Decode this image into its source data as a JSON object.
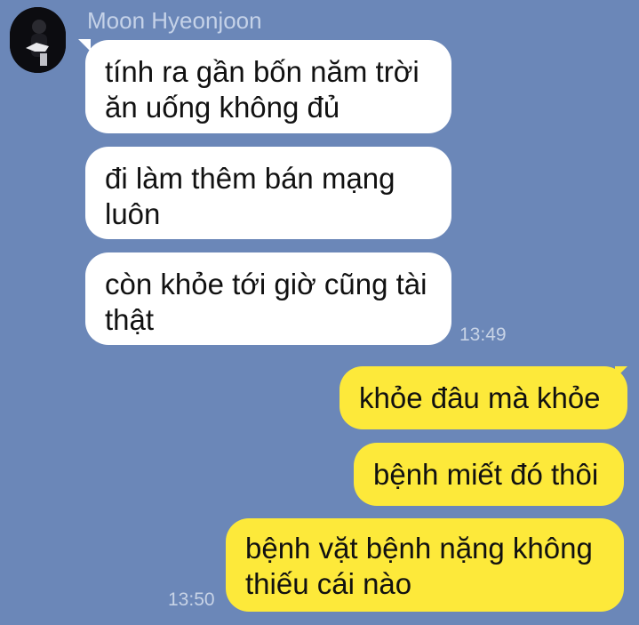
{
  "chat": {
    "sender_name": "Moon Hyeonjoon",
    "avatar_icon": "user-avatar",
    "incoming": [
      {
        "lines": [
          "tính ra gần bốn năm trời",
          "ăn uống không đủ"
        ]
      },
      {
        "lines": [
          "đi làm thêm bán mạng",
          "luôn"
        ]
      },
      {
        "lines": [
          "còn khỏe tới giờ cũng tài",
          "thật"
        ]
      }
    ],
    "incoming_time": "13:49",
    "outgoing": [
      {
        "lines": [
          "khỏe đâu mà khỏe"
        ]
      },
      {
        "lines": [
          "bệnh miết đó thôi"
        ]
      },
      {
        "lines": [
          "bệnh vặt bệnh nặng không",
          "thiếu cái nào"
        ]
      }
    ],
    "outgoing_time": "13:50"
  },
  "colors": {
    "background": "#6b87b8",
    "incoming_bubble": "#ffffff",
    "outgoing_bubble": "#fde93a",
    "meta_text": "#c5d2e8"
  }
}
